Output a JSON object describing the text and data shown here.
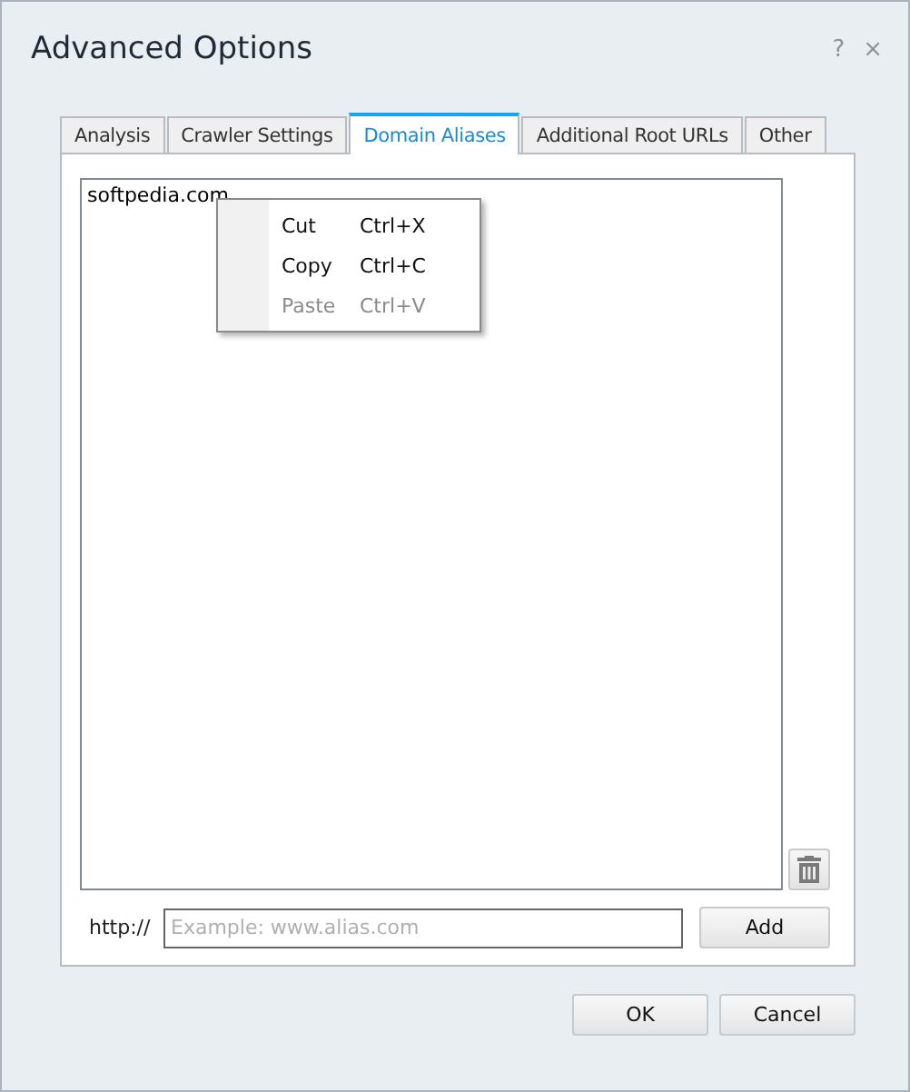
{
  "window": {
    "title": "Advanced Options",
    "help": "?",
    "close": "×"
  },
  "tabs": [
    {
      "label": "Analysis",
      "selected": false
    },
    {
      "label": "Crawler Settings",
      "selected": false
    },
    {
      "label": "Domain Aliases",
      "selected": true
    },
    {
      "label": "Additional Root URLs",
      "selected": false
    },
    {
      "label": "Other",
      "selected": false
    }
  ],
  "aliases": [
    "softpedia.com"
  ],
  "context_menu": [
    {
      "label": "Cut",
      "shortcut": "Ctrl+X",
      "disabled": false
    },
    {
      "label": "Copy",
      "shortcut": "Ctrl+C",
      "disabled": false
    },
    {
      "label": "Paste",
      "shortcut": "Ctrl+V",
      "disabled": true
    }
  ],
  "prefix": "http://",
  "alias_field": {
    "placeholder": "Example: www.alias.com"
  },
  "add_button": "Add",
  "buttons": [
    "OK",
    "Cancel"
  ]
}
